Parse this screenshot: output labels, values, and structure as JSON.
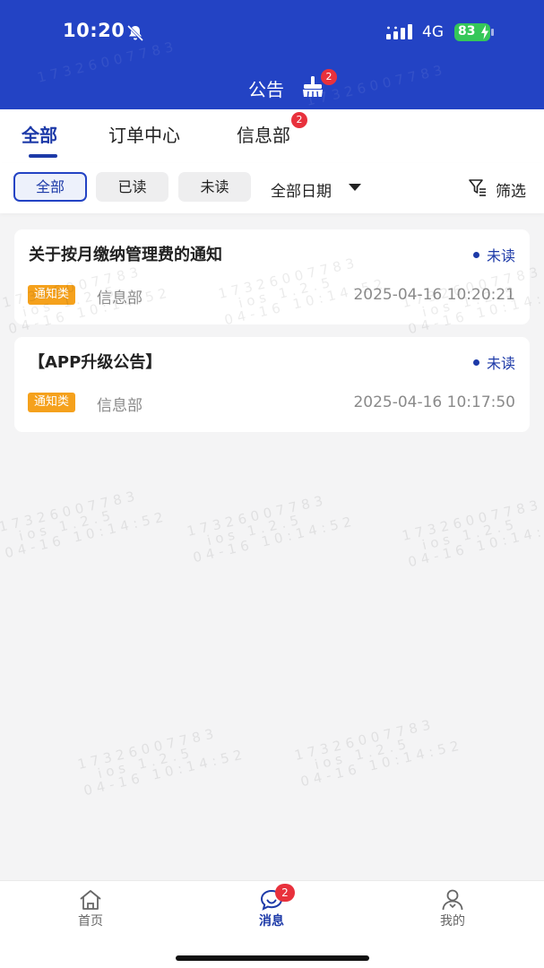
{
  "status_bar": {
    "time": "10:20",
    "network": "4G",
    "battery": "83"
  },
  "header": {
    "title": "公告",
    "clear_badge": "2"
  },
  "tabs": [
    {
      "label": "全部",
      "active": true
    },
    {
      "label": "订单中心",
      "active": false
    },
    {
      "label": "信息部",
      "active": false,
      "badge": "2"
    }
  ],
  "filters": {
    "chips": [
      {
        "label": "全部",
        "active": true
      },
      {
        "label": "已读",
        "active": false
      },
      {
        "label": "未读",
        "active": false
      }
    ],
    "date_label": "全部日期",
    "filter_label": "筛选"
  },
  "notices": [
    {
      "title": "关于按月缴纳管理费的通知",
      "status": "未读",
      "tag": "通知类",
      "department": "信息部",
      "time": "2025-04-16 10:20:21"
    },
    {
      "title": "【APP升级公告】",
      "status": "未读",
      "tag": "通知类",
      "department": "信息部",
      "time": "2025-04-16 10:17:50"
    }
  ],
  "watermark": {
    "line1": "17326007783",
    "line2": "ios 1.2.5",
    "line3": "04-16 10:14:52"
  },
  "bottom_nav": [
    {
      "label": "首页",
      "icon": "home-icon",
      "active": false
    },
    {
      "label": "消息",
      "icon": "message-icon",
      "active": true,
      "badge": "2"
    },
    {
      "label": "我的",
      "icon": "profile-icon",
      "active": false
    }
  ],
  "colors": {
    "primary": "#2343c4",
    "badge": "#e8313c",
    "tag": "#f5a11c",
    "background": "#f4f4f5"
  }
}
